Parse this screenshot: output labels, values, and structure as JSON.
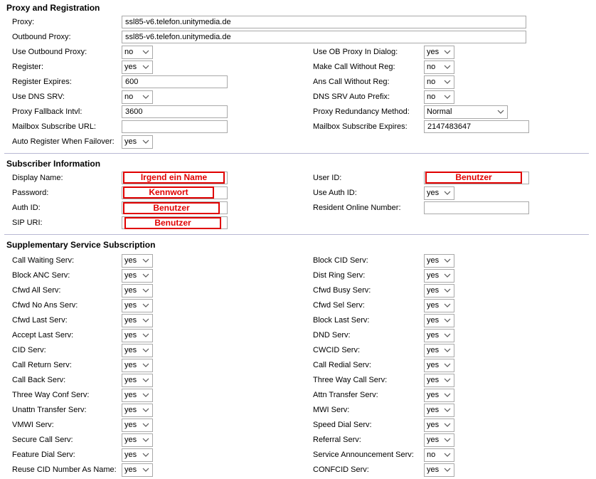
{
  "sections": {
    "proxy": "Proxy and Registration",
    "subscriber": "Subscriber Information",
    "supplementary": "Supplementary Service Subscription"
  },
  "proxy": {
    "proxy_label": "Proxy:",
    "proxy_value": "ssl85-v6.telefon.unitymedia.de",
    "outbound_label": "Outbound Proxy:",
    "outbound_value": "ssl85-v6.telefon.unitymedia.de",
    "use_outbound_label": "Use Outbound Proxy:",
    "use_outbound_value": "no",
    "use_ob_dialog_label": "Use OB Proxy In Dialog:",
    "use_ob_dialog_value": "yes",
    "register_label": "Register:",
    "register_value": "yes",
    "make_call_label": "Make Call Without Reg:",
    "make_call_value": "no",
    "register_expires_label": "Register Expires:",
    "register_expires_value": "600",
    "ans_call_label": "Ans Call Without Reg:",
    "ans_call_value": "no",
    "use_dns_srv_label": "Use DNS SRV:",
    "use_dns_srv_value": "no",
    "dns_srv_prefix_label": "DNS SRV Auto Prefix:",
    "dns_srv_prefix_value": "no",
    "fallback_label": "Proxy Fallback Intvl:",
    "fallback_value": "3600",
    "redundancy_label": "Proxy Redundancy Method:",
    "redundancy_value": "Normal",
    "mailbox_url_label": "Mailbox Subscribe URL:",
    "mailbox_url_value": "",
    "mailbox_expires_label": "Mailbox Subscribe Expires:",
    "mailbox_expires_value": "2147483647",
    "auto_register_label": "Auto Register When Failover:",
    "auto_register_value": "yes"
  },
  "subscriber": {
    "display_name_label": "Display Name:",
    "display_name_value": "Irgend ein Name",
    "user_id_label": "User ID:",
    "user_id_value": "Benutzer",
    "password_label": "Password:",
    "password_value": "Kennwort",
    "use_auth_id_label": "Use Auth ID:",
    "use_auth_id_value": "yes",
    "auth_id_label": "Auth ID:",
    "auth_id_value": "Benutzer",
    "resident_label": "Resident Online Number:",
    "resident_value": "",
    "sip_uri_label": "SIP URI:",
    "sip_uri_value": "Benutzer"
  },
  "supplementary": {
    "left": [
      {
        "label": "Call Waiting Serv:",
        "value": "yes"
      },
      {
        "label": "Block ANC Serv:",
        "value": "yes"
      },
      {
        "label": "Cfwd All Serv:",
        "value": "yes"
      },
      {
        "label": "Cfwd No Ans Serv:",
        "value": "yes"
      },
      {
        "label": "Cfwd Last Serv:",
        "value": "yes"
      },
      {
        "label": "Accept Last Serv:",
        "value": "yes"
      },
      {
        "label": "CID Serv:",
        "value": "yes"
      },
      {
        "label": "Call Return Serv:",
        "value": "yes"
      },
      {
        "label": "Call Back Serv:",
        "value": "yes"
      },
      {
        "label": "Three Way Conf Serv:",
        "value": "yes"
      },
      {
        "label": "Unattn Transfer Serv:",
        "value": "yes"
      },
      {
        "label": "VMWI Serv:",
        "value": "yes"
      },
      {
        "label": "Secure Call Serv:",
        "value": "yes"
      },
      {
        "label": "Feature Dial Serv:",
        "value": "yes"
      },
      {
        "label": "Reuse CID Number As Name:",
        "value": "yes"
      }
    ],
    "right": [
      {
        "label": "Block CID Serv:",
        "value": "yes"
      },
      {
        "label": "Dist Ring Serv:",
        "value": "yes"
      },
      {
        "label": "Cfwd Busy Serv:",
        "value": "yes"
      },
      {
        "label": "Cfwd Sel Serv:",
        "value": "yes"
      },
      {
        "label": "Block Last Serv:",
        "value": "yes"
      },
      {
        "label": "DND Serv:",
        "value": "yes"
      },
      {
        "label": "CWCID Serv:",
        "value": "yes"
      },
      {
        "label": "Call Redial Serv:",
        "value": "yes"
      },
      {
        "label": "Three Way Call Serv:",
        "value": "yes"
      },
      {
        "label": "Attn Transfer Serv:",
        "value": "yes"
      },
      {
        "label": "MWI Serv:",
        "value": "yes"
      },
      {
        "label": "Speed Dial Serv:",
        "value": "yes"
      },
      {
        "label": "Referral Serv:",
        "value": "yes"
      },
      {
        "label": "Service Announcement Serv:",
        "value": "no"
      },
      {
        "label": "CONFCID Serv:",
        "value": "yes"
      }
    ]
  },
  "colors": {
    "separator": "#b8b8d4",
    "redaction": "#e00000"
  }
}
